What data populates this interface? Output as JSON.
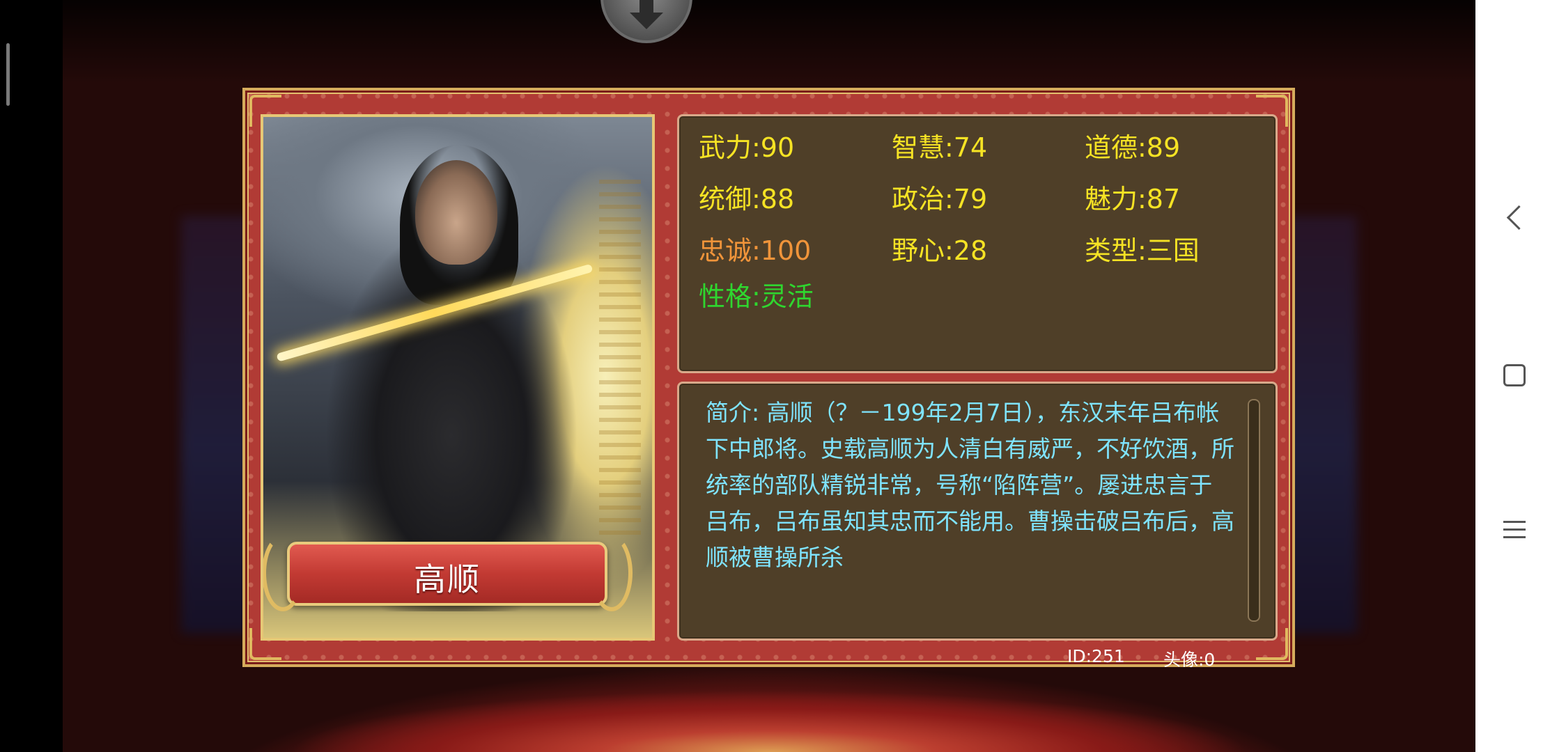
{
  "hero": {
    "name": "高顺"
  },
  "stats": {
    "wuli": "武力:90",
    "zhihui": "智慧:74",
    "daode": "道德:89",
    "tongyu": "统御:88",
    "zhengzhi": "政治:79",
    "meili": "魅力:87",
    "zhongcheng": "忠诚:100",
    "yexin": "野心:28",
    "leixing": "类型:三国",
    "xingge": "性格:灵活"
  },
  "description": {
    "text": "简介: 高顺（？－199年2月7日），东汉末年吕布帐下中郎将。史载高顺为人清白有威严，不好饮酒，所统率的部队精锐非常，号称“陷阵营”。屡进忠言于吕布，吕布虽知其忠而不能用。曹操击破吕布后，高顺被曹操所杀"
  },
  "footer": {
    "id": "ID:251",
    "avatar": "头像:0"
  },
  "colors": {
    "stat_primary": "#f6e324",
    "stat_loyalty": "#f0943a",
    "stat_personality": "#2fd62f",
    "description_text": "#7fe4ff",
    "panel_red": "#b13b35",
    "box_brown": "#4f3f28"
  },
  "icons": {
    "close_or_collapse": "down-arrow-icon",
    "nav_back": "back-chevron-icon",
    "nav_home": "home-square-icon",
    "nav_recents": "menu-lines-icon"
  }
}
